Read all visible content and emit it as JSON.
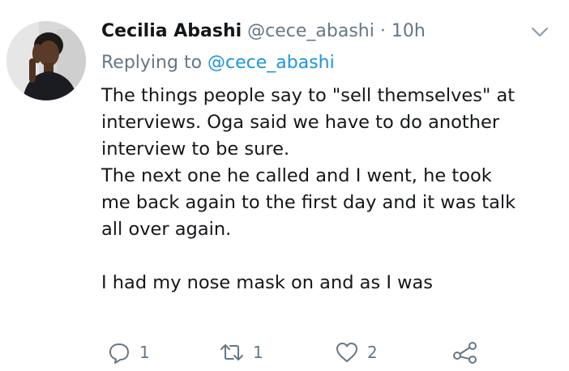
{
  "tweet": {
    "author": {
      "display_name": "Cecilia Abashi",
      "handle": "@cece_abashi",
      "separator": "·",
      "timestamp": "10h"
    },
    "replying_to": {
      "prefix": "Replying to",
      "handle": "@cece_abashi"
    },
    "body_lines": [
      "The things people say to \"sell themselves\" at",
      "interviews.  Oga said we have to do another",
      "interview to be sure.",
      "The next one he called and I went,  he took",
      "me back again to the first day and it was talk",
      "all over again.",
      "",
      "I had my nose mask on and as I was"
    ],
    "actions": {
      "reply_count": "1",
      "retweet_count": "1",
      "like_count": "2"
    },
    "icons": {
      "menu": "chevron-down-icon",
      "reply": "reply-icon",
      "retweet": "retweet-icon",
      "like": "heart-icon",
      "share": "share-icon"
    },
    "colors": {
      "link": "#1b95e0",
      "muted": "#657786",
      "text": "#14171a"
    }
  }
}
